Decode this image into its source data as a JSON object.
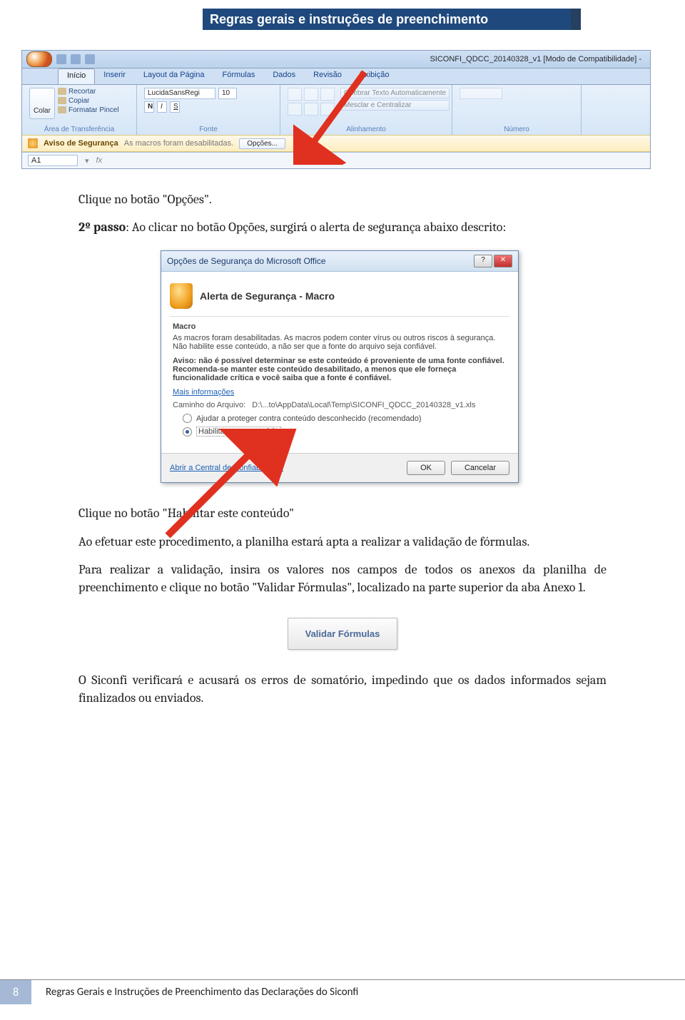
{
  "header_banner": "Regras gerais e instruções de preenchimento",
  "excel": {
    "title_bar": "SICONFI_QDCC_20140328_v1 [Modo de Compatibilidade] - ",
    "tabs": [
      "Início",
      "Inserir",
      "Layout da Página",
      "Fórmulas",
      "Dados",
      "Revisão",
      "Exibição"
    ],
    "clipboard": {
      "paste": "Colar",
      "cut": "Recortar",
      "copy": "Copiar",
      "format_painter": "Formatar Pincel",
      "group": "Área de Transferência"
    },
    "font": {
      "name": "LucidaSansRegi",
      "size": "10",
      "group": "Fonte"
    },
    "alignment": {
      "wrap": "Quebrar Texto Automaticamente",
      "merge": "Mesclar e Centralizar",
      "group": "Alinhamento"
    },
    "number_group": "Número",
    "security_bar": {
      "title": "Aviso de Segurança",
      "message": "As macros foram desabilitadas.",
      "button": "Opções..."
    },
    "name_box": "A1",
    "fx_label": "fx"
  },
  "text": {
    "p1": "Clique no botão \"Opções\".",
    "p2_label": "2º passo",
    "p2_rest": ": Ao clicar no botão Opções, surgirá o alerta de segurança abaixo descrito:",
    "p3": "Clique no botão \"Habilitar este conteúdo\"",
    "p4": "Ao efetuar este procedimento, a planilha estará apta a realizar a validação de fórmulas.",
    "p5": "Para realizar a validação, insira os valores nos campos de todos os anexos da planilha de preenchimento e clique no botão \"Validar Fórmulas\", localizado na parte superior da aba Anexo 1.",
    "p6": "O Siconfi verificará e acusará os erros de somatório, impedindo que os dados informados sejam finalizados ou enviados."
  },
  "dialog": {
    "title": "Opções de Segurança do Microsoft Office",
    "alert_title": "Alerta de Segurança - Macro",
    "macro_label": "Macro",
    "macro_desc": "As macros foram desabilitadas. As macros podem conter vírus ou outros riscos à segurança. Não habilite esse conteúdo, a não ser que a fonte do arquivo seja confiável.",
    "warn": "Aviso: não é possível determinar se este conteúdo é proveniente de uma fonte confiável. Recomenda-se manter este conteúdo desabilitado, a menos que ele forneça funcionalidade crítica e você saiba que a fonte é confiável.",
    "more_info": "Mais informações",
    "path_label": "Caminho do Arquivo:",
    "path_value": "D:\\...to\\AppData\\Local\\Temp\\SICONFI_QDCC_20140328_v1.xls",
    "opt1": "Ajudar a proteger contra conteúdo desconhecido (recomendado)",
    "opt2": "Habilitar este conteúdo",
    "trust_center": "Abrir a Central de Confiabilidade",
    "ok": "OK",
    "cancel": "Cancelar"
  },
  "validate_button": "Validar Fórmulas",
  "footer": {
    "page": "8",
    "text": "Regras Gerais e Instruções de Preenchimento das Declarações do Siconfi"
  }
}
